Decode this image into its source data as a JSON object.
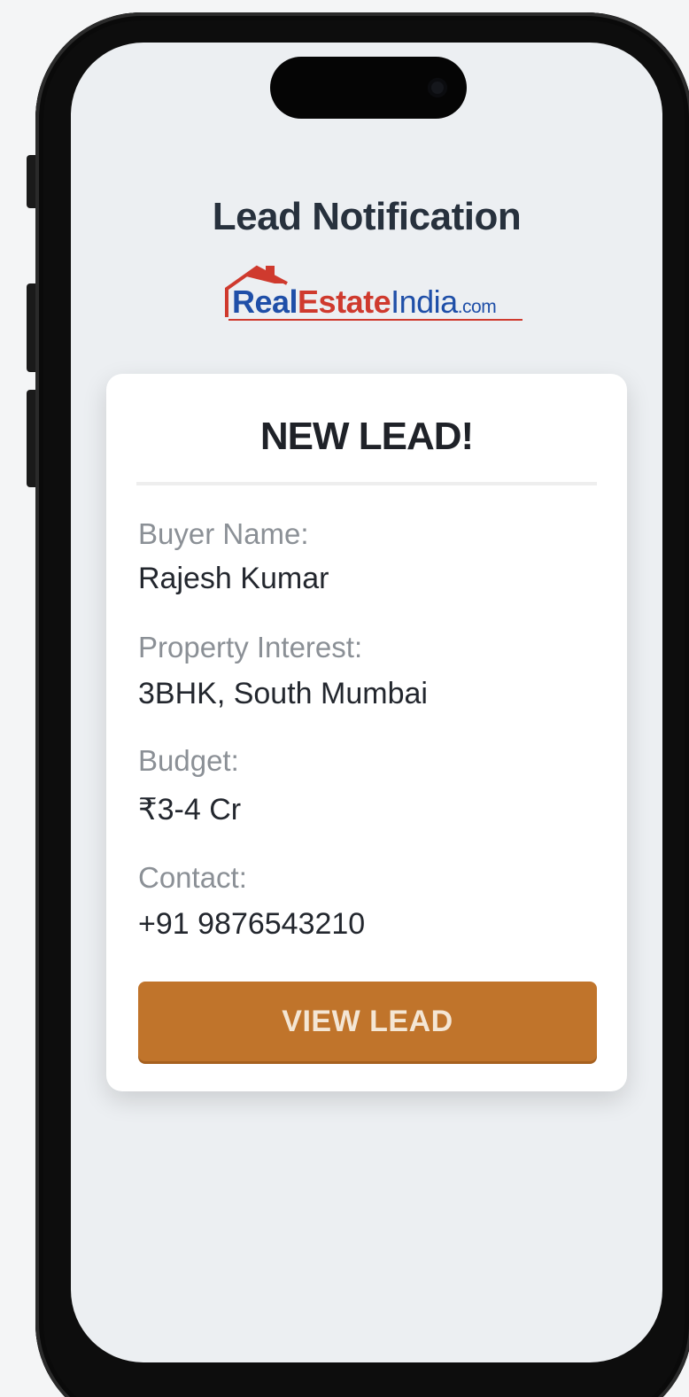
{
  "screen": {
    "title": "Lead Notification"
  },
  "logo": {
    "part_real": "Real",
    "part_estate": "Estate",
    "part_india": "India",
    "part_com": ".com",
    "roof_icon": "house-roof-icon",
    "colors": {
      "blue": "#1f4fa8",
      "red": "#cf3a2e"
    }
  },
  "card": {
    "heading": "NEW LEAD!",
    "fields": {
      "buyer_label": "Buyer Name:",
      "buyer_value": "Rajesh Kumar",
      "property_label": "Property Interest:",
      "property_value": "3BHK, South Mumbai",
      "budget_label": "Budget:",
      "budget_value": "₹3-4 Cr",
      "contact_label": "Contact:",
      "contact_value": "+91 9876543210"
    },
    "button_label": "VIEW LEAD",
    "button_color": "#c0742b"
  }
}
